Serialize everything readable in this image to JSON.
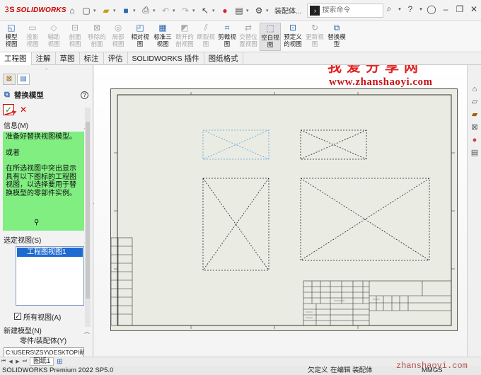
{
  "app": {
    "logo_text": "SOLIDWORKS",
    "doc_title": "装配体...",
    "search_placeholder": "搜索命令"
  },
  "ribbon": {
    "buttons": [
      {
        "label": "模型视图",
        "enabled": true
      },
      {
        "label": "投影视图",
        "enabled": false
      },
      {
        "label": "辅助视图",
        "enabled": false
      },
      {
        "label": "剖面视图",
        "enabled": false
      },
      {
        "label": "移除的剖面",
        "enabled": false
      },
      {
        "label": "局部视图",
        "enabled": false
      },
      {
        "label": "相对视图",
        "enabled": true
      },
      {
        "label": "标准三视图",
        "enabled": true
      },
      {
        "label": "断开的剖视图",
        "enabled": false
      },
      {
        "label": "断裂视图",
        "enabled": false
      },
      {
        "label": "剪裁视图",
        "enabled": true
      },
      {
        "label": "交替位置视图",
        "enabled": false
      },
      {
        "label": "空白视图",
        "enabled": true
      },
      {
        "label": "预定义的视图",
        "enabled": true
      },
      {
        "label": "更新视图",
        "enabled": false
      },
      {
        "label": "替换模型",
        "enabled": true
      }
    ]
  },
  "tabs": [
    "工程图",
    "注解",
    "草图",
    "标注",
    "评估",
    "SOLIDWORKS 插件",
    "图纸格式"
  ],
  "panel": {
    "title": "替换模型",
    "info_header": "信息(M)",
    "info_text": [
      "准备好替换视图模型。",
      "或者",
      "在所选视图中突出显示具有以下图标的工程图视图，以选择要用于替换模型的零部件实例。"
    ],
    "selected_views_header": "选定视图(S)",
    "selected_view_item": "工程图视图1",
    "all_views_label": "所有视图(A)",
    "new_model_header": "新建模型(N)",
    "part_asm_label": "零件/装配体(Y)",
    "path_value": "C:\\USERS\\ZSY\\DESKTOP\\新"
  },
  "watermark": {
    "cn": "我爱分享网",
    "en": "www.zhanshaoyi.com",
    "footer": "zhanshaoyi.com"
  },
  "sheet_tab": "图纸1",
  "status": {
    "product": "SOLIDWORKS Premium 2022 SP5.0",
    "defined": "欠定义",
    "editing": "在编辑 装配体",
    "units": "MMGS"
  }
}
